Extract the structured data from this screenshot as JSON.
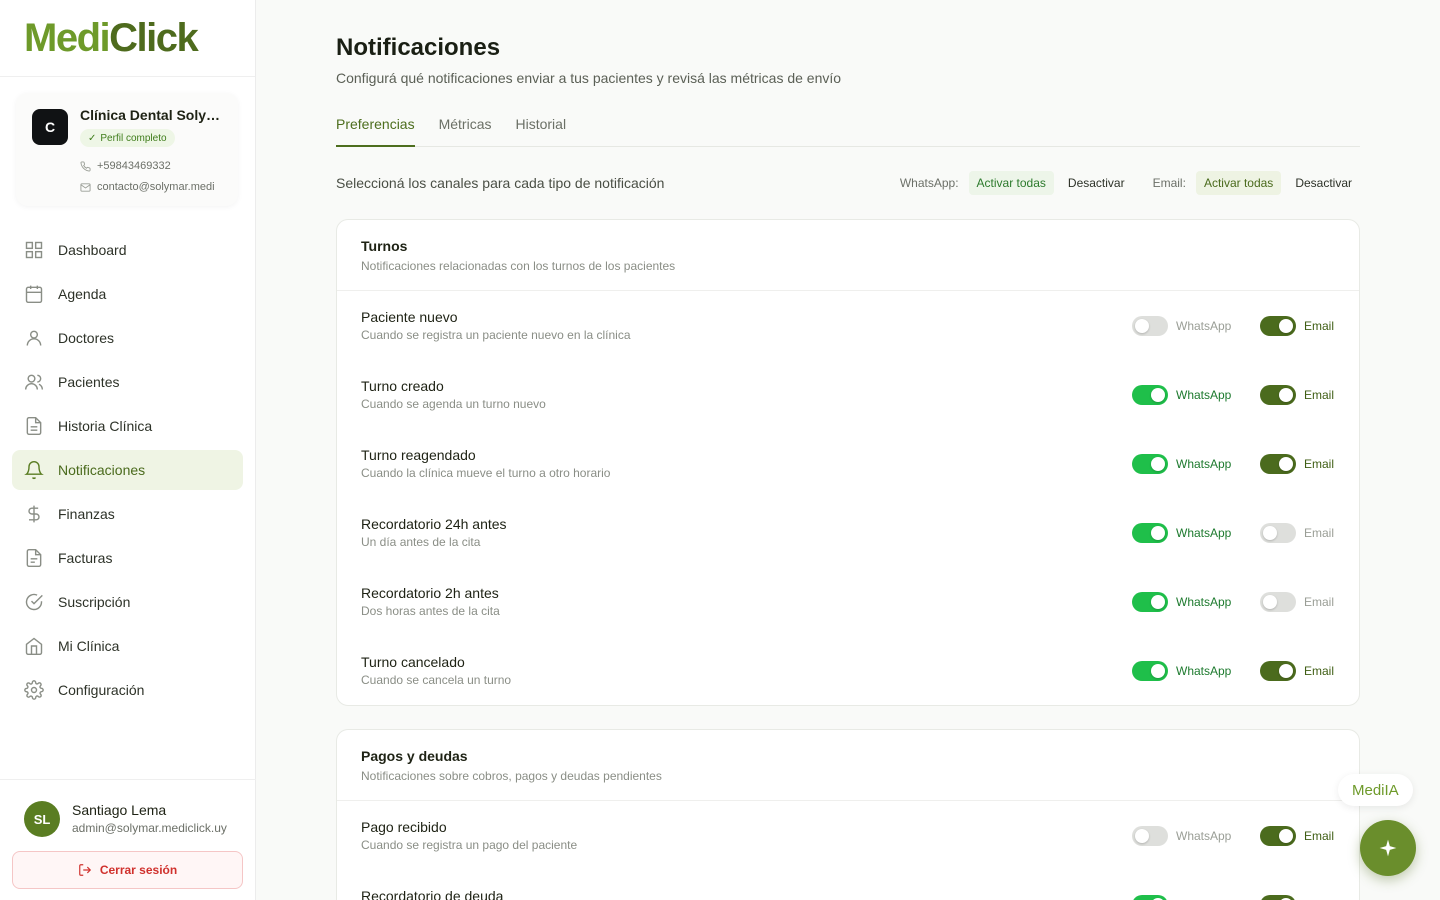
{
  "brand": {
    "logo_part1": "Medi",
    "logo_part2": "Click"
  },
  "clinic": {
    "avatar": "C",
    "name": "Clínica Dental Solymar",
    "badge": "Perfil completo",
    "phone": "+59843469332",
    "email": "contacto@solymar.medi"
  },
  "nav": [
    {
      "label": "Dashboard",
      "icon": "grid-icon"
    },
    {
      "label": "Agenda",
      "icon": "calendar-icon"
    },
    {
      "label": "Doctores",
      "icon": "user-icon"
    },
    {
      "label": "Pacientes",
      "icon": "users-icon"
    },
    {
      "label": "Historia Clínica",
      "icon": "file-icon"
    },
    {
      "label": "Notificaciones",
      "icon": "bell-icon",
      "active": true
    },
    {
      "label": "Finanzas",
      "icon": "dollar-icon"
    },
    {
      "label": "Facturas",
      "icon": "invoice-icon"
    },
    {
      "label": "Suscripción",
      "icon": "check-circle-icon"
    },
    {
      "label": "Mi Clínica",
      "icon": "home-icon"
    },
    {
      "label": "Configuración",
      "icon": "gear-icon"
    }
  ],
  "user": {
    "initials": "SL",
    "name": "Santiago Lema",
    "email": "admin@solymar.mediclick.uy",
    "logout": "Cerrar sesión"
  },
  "page": {
    "title": "Notificaciones",
    "subtitle": "Configurá qué notificaciones enviar a tus pacientes y revisá las métricas de envío",
    "tabs": [
      "Preferencias",
      "Métricas",
      "Historial"
    ],
    "active_tab": 0
  },
  "bulk": {
    "label": "Seleccioná los canales para cada tipo de notificación",
    "whatsapp_label": "WhatsApp:",
    "email_label": "Email:",
    "activate_all": "Activar todas",
    "deactivate": "Desactivar"
  },
  "channels": {
    "whatsapp": "WhatsApp",
    "email": "Email"
  },
  "sections": [
    {
      "title": "Turnos",
      "subtitle": "Notificaciones relacionadas con los turnos de los pacientes",
      "rows": [
        {
          "title": "Paciente nuevo",
          "desc": "Cuando se registra un paciente nuevo en la clínica",
          "whatsapp": false,
          "email": true
        },
        {
          "title": "Turno creado",
          "desc": "Cuando se agenda un turno nuevo",
          "whatsapp": true,
          "email": true
        },
        {
          "title": "Turno reagendado",
          "desc": "Cuando la clínica mueve el turno a otro horario",
          "whatsapp": true,
          "email": true
        },
        {
          "title": "Recordatorio 24h antes",
          "desc": "Un día antes de la cita",
          "whatsapp": true,
          "email": false
        },
        {
          "title": "Recordatorio 2h antes",
          "desc": "Dos horas antes de la cita",
          "whatsapp": true,
          "email": false
        },
        {
          "title": "Turno cancelado",
          "desc": "Cuando se cancela un turno",
          "whatsapp": true,
          "email": true
        }
      ]
    },
    {
      "title": "Pagos y deudas",
      "subtitle": "Notificaciones sobre cobros, pagos y deudas pendientes",
      "rows": [
        {
          "title": "Pago recibido",
          "desc": "Cuando se registra un pago del paciente",
          "whatsapp": false,
          "email": true
        },
        {
          "title": "Recordatorio de deuda",
          "desc": "",
          "whatsapp": true,
          "email": true
        }
      ]
    }
  ],
  "assistant": {
    "label": "MediIA",
    "icon": "sparkle-icon"
  }
}
